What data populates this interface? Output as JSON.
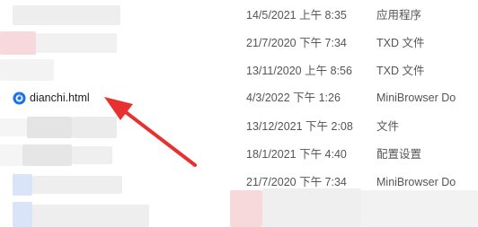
{
  "files": [
    {
      "name": "",
      "date": "14/5/2021 上午 8:35",
      "type": "应用程序"
    },
    {
      "name": "",
      "date": "21/7/2020 下午 7:34",
      "type": "TXD 文件"
    },
    {
      "name": "",
      "date": "13/11/2020 上午 8:56",
      "type": "TXD 文件"
    },
    {
      "name": "dianchi.html",
      "date": "4/3/2022 下午 1:26",
      "type": "MiniBrowser Do",
      "icon": "browser-globe-icon"
    },
    {
      "name": "",
      "date": "13/12/2021 下午 2:08",
      "type": "文件"
    },
    {
      "name": "",
      "date": "18/1/2021 下午 4:40",
      "type": "配置设置"
    },
    {
      "name": "",
      "date": "21/7/2020 下午 7:34",
      "type": "MiniBrowser Do"
    }
  ],
  "colors": {
    "arrow": "#e8312e",
    "icon_blue": "#1a73e8",
    "blur_light": "#eeeeee",
    "blur_pink": "#f7d9db",
    "blur_blue": "#d9e4f8"
  },
  "annotation": {
    "icon": "red-arrow-icon"
  }
}
